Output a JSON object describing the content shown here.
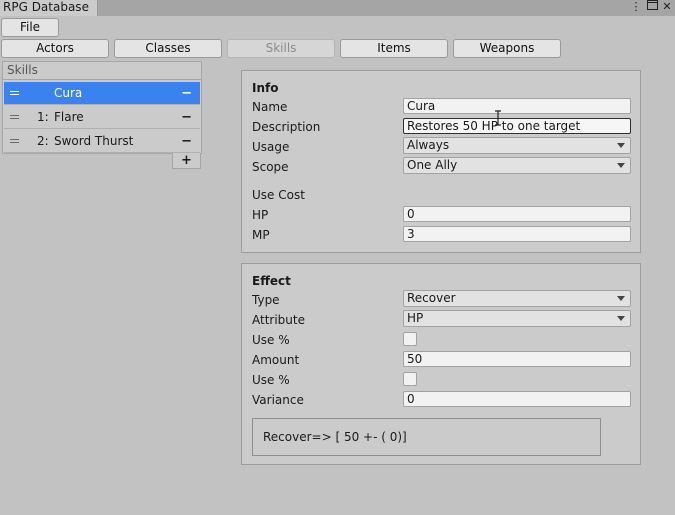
{
  "window": {
    "title": "RPG Database",
    "menu_icon": "kebab-menu-icon",
    "maximize_icon": "maximize-icon",
    "close_icon": "close-icon"
  },
  "toolbar": {
    "file_label": "File"
  },
  "tabs": [
    {
      "label": "Actors",
      "active": false
    },
    {
      "label": "Classes",
      "active": false
    },
    {
      "label": "Skills",
      "active": true
    },
    {
      "label": "Items",
      "active": false
    },
    {
      "label": "Weapons",
      "active": false
    }
  ],
  "skills_list": {
    "header": "Skills",
    "items": [
      {
        "index": "",
        "label": "Cura",
        "selected": true
      },
      {
        "index": "1:",
        "label": "Flare",
        "selected": false
      },
      {
        "index": "2:",
        "label": "Sword Thurst",
        "selected": false
      }
    ],
    "remove_symbol": "−",
    "add_symbol": "+"
  },
  "info": {
    "title": "Info",
    "name_label": "Name",
    "name_value": "Cura",
    "description_label": "Description",
    "description_value": "Restores 50 HP to one target",
    "usage_label": "Usage",
    "usage_value": "Always",
    "scope_label": "Scope",
    "scope_value": "One Ally",
    "use_cost_label": "Use Cost",
    "hp_label": "HP",
    "hp_value": "0",
    "mp_label": "MP",
    "mp_value": "3"
  },
  "effect": {
    "title": "Effect",
    "type_label": "Type",
    "type_value": "Recover",
    "attribute_label": "Attribute",
    "attribute_value": "HP",
    "use_pct_label_1": "Use %",
    "use_pct_checked_1": false,
    "amount_label": "Amount",
    "amount_value": "50",
    "use_pct_label_2": "Use %",
    "use_pct_checked_2": false,
    "variance_label": "Variance",
    "variance_value": "0",
    "summary": "Recover=> [ 50 +- ( 0)]"
  },
  "colors": {
    "selection": "#3a82f0",
    "panel": "#cbcbcb",
    "background": "#c2c2c2"
  }
}
